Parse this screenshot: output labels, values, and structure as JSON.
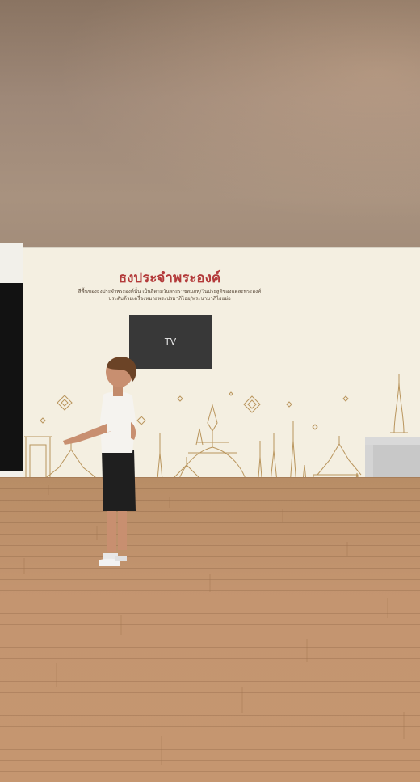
{
  "scene": {
    "mural": {
      "title": "ธงประจำพระองค์",
      "subtitle_line1": "สีพื้นของธงประจำพระองค์นั้น เป็นสีตามวันพระราชสมภพ/วันประสูติของแต่ละพระองค์",
      "subtitle_line2": "ประดับด้วยเครื่องหมายพระปรมาภิไธย/พระนามาภิไธยย่อ"
    },
    "tv": {
      "label": "TV"
    },
    "colors": {
      "wall": "#f4efe1",
      "title": "#b33a3a",
      "ornament": "#b9955d",
      "floor": "#c49570",
      "ceiling": "#9e8878"
    },
    "icons": [
      "avatar-boy",
      "temple-skyline",
      "diamond-ornament"
    ]
  }
}
